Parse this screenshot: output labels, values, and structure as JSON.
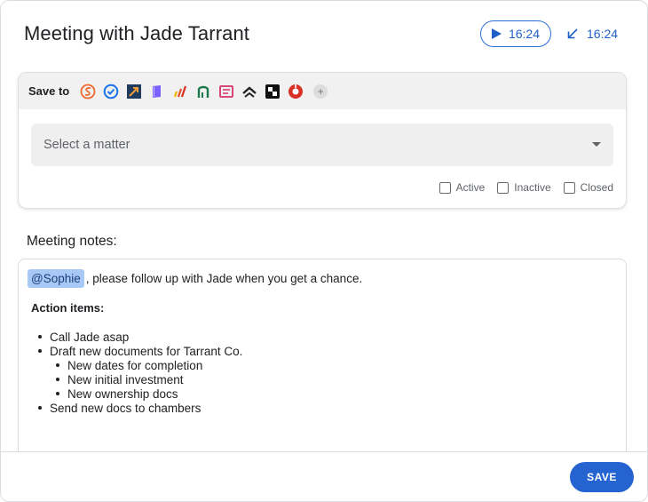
{
  "header": {
    "title": "Meeting with Jade Tarrant",
    "play_time": "16:24",
    "minimize_time": "16:24"
  },
  "save_to": {
    "label": "Save to",
    "integrations": [
      {
        "name": "orange-s-app",
        "color": "#f0682a"
      },
      {
        "name": "blue-check-app",
        "color": "#1a73e8"
      },
      {
        "name": "dark-arrow-app",
        "color": "#1e3a5f"
      },
      {
        "name": "purple-book-app",
        "color": "#7b61ff"
      },
      {
        "name": "bars-app",
        "color": "#e2502a"
      },
      {
        "name": "green-a-app",
        "color": "#1b7a4a"
      },
      {
        "name": "pink-frame-app",
        "color": "#d6336c"
      },
      {
        "name": "chevrons-app",
        "color": "#222222"
      },
      {
        "name": "black-square-app",
        "color": "#111111"
      },
      {
        "name": "red-circle-app",
        "color": "#d93025"
      }
    ],
    "add_label": "+"
  },
  "matter": {
    "placeholder": "Select a matter"
  },
  "filters": [
    {
      "label": "Active",
      "checked": false
    },
    {
      "label": "Inactive",
      "checked": false
    },
    {
      "label": "Closed",
      "checked": false
    }
  ],
  "notes": {
    "label": "Meeting notes:",
    "mention": "@Sophie",
    "first_line": ", please follow up with Jade when you get a chance.",
    "action_heading": "Action items:",
    "items": [
      {
        "text": "Call Jade asap",
        "level": 1
      },
      {
        "text": "Draft new documents for Tarrant Co.",
        "level": 1
      },
      {
        "text": "New dates for completion",
        "level": 2
      },
      {
        "text": "New initial investment",
        "level": 2
      },
      {
        "text": "New ownership docs",
        "level": 2
      },
      {
        "text": "Send new docs to chambers",
        "level": 1
      }
    ]
  },
  "footer": {
    "save_label": "SAVE"
  },
  "colors": {
    "accent": "#2563d0",
    "mention_bg": "#a8c8f5"
  }
}
